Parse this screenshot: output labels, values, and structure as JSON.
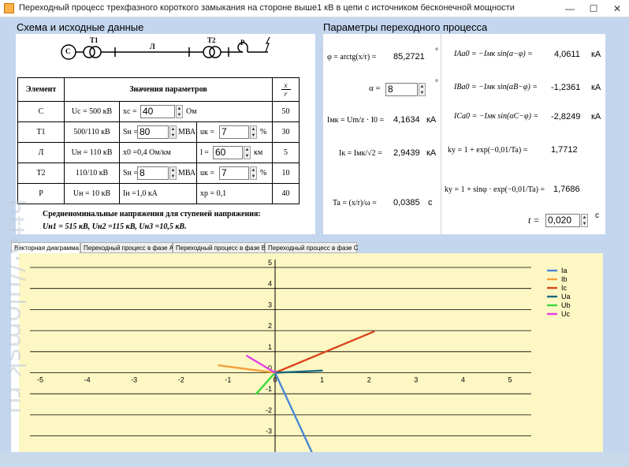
{
  "window": {
    "title": "Переходный процесс трехфазного короткого замыкания на стороне выше1 кВ в цепи с источником бесконечной мощности",
    "minimize": "—",
    "maximize": "☐",
    "close": "✕"
  },
  "scheme": {
    "heading": "Схема и исходные данные",
    "labels": {
      "source": "C",
      "t1": "T1",
      "line": "Л",
      "t2": "T2",
      "fault": "Р"
    },
    "table": {
      "headers": {
        "element": "Элемент",
        "values": "Значения параметров",
        "xr_top": "x",
        "xr_bottom": "r"
      },
      "rows": [
        {
          "element": "C",
          "c1": "Uс = 500 кВ",
          "p1": "xс =",
          "v1": "40",
          "u1": "Ом",
          "xr": "50"
        },
        {
          "element": "T1",
          "c1": "500/110 кВ",
          "p1": "Sн =",
          "v1": "80",
          "u1": "МВА",
          "p2": "uк =",
          "v2": "7",
          "u2": "%",
          "xr": "30"
        },
        {
          "element": "Л",
          "c1": "Uн = 110 кВ",
          "p1": "x0 =0,4 Ом/км",
          "p2": "l =",
          "v2": "60",
          "u2": "км",
          "xr": "5"
        },
        {
          "element": "T2",
          "c1": "110/10 кВ",
          "p1": "Sн =",
          "v1": "8",
          "u1": "МВА",
          "p2": "uк =",
          "v2": "7",
          "u2": "%",
          "xr": "10"
        },
        {
          "element": "Р",
          "c1": "Uн = 10 кВ",
          "p1": "Iн =1,0 кА",
          "p2": "xр = 0,1",
          "xr": "40"
        }
      ]
    },
    "nominal_heading": "Средненоминальные напряжения для ступеней напряжения:",
    "nominal_values": "Uн1 = 515 кВ, Uн2 =115 кВ, Uн3 =10,5 кВ."
  },
  "params": {
    "heading": "Параметры переходного процесса",
    "phi": {
      "formula": "φ = arctg(x/r) =",
      "value": "85,2721",
      "unit": "°"
    },
    "alpha": {
      "label": "α =",
      "value": "8",
      "unit": "°"
    },
    "imk": {
      "formula": "Iмк = Um/z · I0 =",
      "value": "4,1634",
      "unit": "кА"
    },
    "ik": {
      "formula": "Iк = Iмк/√2 =",
      "value": "2,9439",
      "unit": "кА"
    },
    "ta": {
      "formula": "Ta = (x/r)/ω =",
      "value": "0,0385",
      "unit": "с"
    },
    "ia0": {
      "formula": "IAa0 = −Iмк sin(α−φ) =",
      "value": "4,0611",
      "unit": "кА"
    },
    "ib0": {
      "formula": "IBa0 = −Iмк sin(αB−φ) =",
      "value": "-1,2361",
      "unit": "кА"
    },
    "ic0": {
      "formula": "ICa0 = −Iмк sin(αC−φ) =",
      "value": "-2,8249",
      "unit": "кА"
    },
    "ky1": {
      "formula": "kу = 1 + exp(−0,01/Ta) =",
      "value": "1,7712"
    },
    "ky2": {
      "formula": "kу = 1 + sinφ · exp(−0,01/Ta) =",
      "value": "1,7686"
    },
    "t": {
      "label": "t =",
      "value": "0,020",
      "unit": "с"
    }
  },
  "tabs": [
    {
      "label": "Векторная диаграмма",
      "active": true
    },
    {
      "label": "Переходный процесс в фазе A",
      "active": false
    },
    {
      "label": "Переходный процесс в фазе B",
      "active": false
    },
    {
      "label": "Переходный процесс в фазе C",
      "active": false
    }
  ],
  "watermark": "http://ulomsk.ru",
  "chart_data": {
    "type": "line",
    "xlim": [
      -5,
      5
    ],
    "ylim": [
      -3.5,
      5
    ],
    "x_ticks": [
      "-5",
      "-4",
      "-3",
      "-2",
      "-1",
      "0",
      "1",
      "2",
      "3",
      "4",
      "5"
    ],
    "y_ticks": [
      "5",
      "4",
      "3",
      "2",
      "1",
      "0",
      "-1",
      "-2",
      "-3"
    ],
    "grid": "horizontal",
    "legend_position": "top-right",
    "plot_background": "#fdf7c3",
    "series": [
      {
        "name": "Ia",
        "color": "#4a87d4",
        "x": [
          0,
          0.85
        ],
        "y": [
          0,
          -4.1
        ]
      },
      {
        "name": "Ib",
        "color": "#f4a13c",
        "x": [
          0,
          -1.2
        ],
        "y": [
          0,
          0.35
        ]
      },
      {
        "name": "Ic",
        "color": "#d9461e",
        "x": [
          0,
          2.1
        ],
        "y": [
          0,
          1.95
        ]
      },
      {
        "name": "Ua",
        "color": "#1a6b7e",
        "x": [
          0,
          1.0
        ],
        "y": [
          0,
          0.1
        ]
      },
      {
        "name": "Ub",
        "color": "#39d939",
        "x": [
          0,
          -0.4
        ],
        "y": [
          0,
          -1.0
        ]
      },
      {
        "name": "Uc",
        "color": "#e63fe6",
        "x": [
          0,
          -0.6
        ],
        "y": [
          0,
          0.8
        ]
      }
    ]
  }
}
